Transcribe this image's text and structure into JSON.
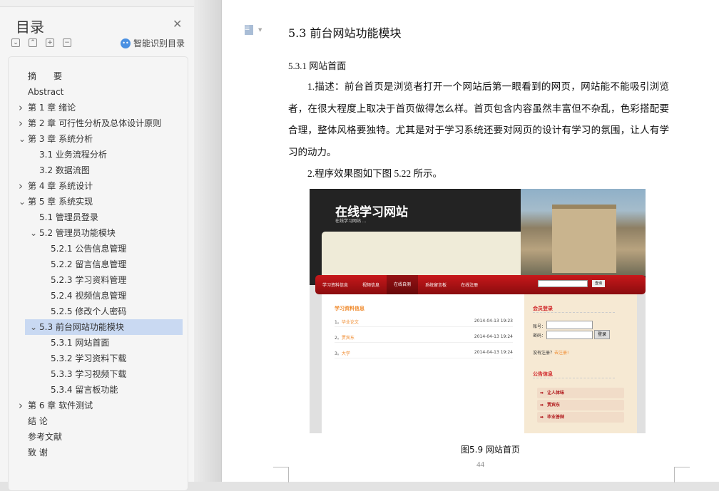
{
  "toc_panel": {
    "title": "目录",
    "smart_label": "智能识别目录",
    "items": [
      {
        "label": "摘　　要",
        "level": 0,
        "chev": ""
      },
      {
        "label": "Abstract",
        "level": 0,
        "chev": ""
      },
      {
        "label": "第 1 章  绪论",
        "level": 0,
        "chev": ">"
      },
      {
        "label": "第 2 章  可行性分析及总体设计原则",
        "level": 0,
        "chev": ">"
      },
      {
        "label": "第 3 章  系统分析",
        "level": 0,
        "chev": "v"
      },
      {
        "label": "3.1 业务流程分析",
        "level": 1,
        "chev": ""
      },
      {
        "label": "3.2 数据流图",
        "level": 1,
        "chev": ""
      },
      {
        "label": "第 4 章  系统设计",
        "level": 0,
        "chev": ">"
      },
      {
        "label": "第 5 章  系统实现",
        "level": 0,
        "chev": "v"
      },
      {
        "label": "5.1 管理员登录",
        "level": 1,
        "chev": ""
      },
      {
        "label": "5.2 管理员功能模块",
        "level": 1,
        "chev": "v"
      },
      {
        "label": "5.2.1 公告信息管理",
        "level": 2,
        "chev": ""
      },
      {
        "label": "5.2.2 留言信息管理",
        "level": 2,
        "chev": ""
      },
      {
        "label": "5.2.3 学习资料管理",
        "level": 2,
        "chev": ""
      },
      {
        "label": "5.2.4 视频信息管理",
        "level": 2,
        "chev": ""
      },
      {
        "label": "5.2.5 修改个人密码",
        "level": 2,
        "chev": ""
      },
      {
        "label": "5.3 前台网站功能模块",
        "level": 1,
        "chev": "v",
        "selected": true
      },
      {
        "label": "5.3.1 网站首面",
        "level": 2,
        "chev": ""
      },
      {
        "label": "5.3.2 学习资料下载",
        "level": 2,
        "chev": ""
      },
      {
        "label": "5.3.3 学习视频下载",
        "level": 2,
        "chev": ""
      },
      {
        "label": "5.3.4 留言板功能",
        "level": 2,
        "chev": ""
      },
      {
        "label": "第 6 章  软件测试",
        "level": 0,
        "chev": ">"
      },
      {
        "label": "结  论",
        "level": 0,
        "chev": ""
      },
      {
        "label": "参考文献",
        "level": 0,
        "chev": ""
      },
      {
        "label": "致    谢",
        "level": 0,
        "chev": ""
      }
    ]
  },
  "document": {
    "heading": "5.3 前台网站功能模块",
    "subheading": "5.3.1 网站首面",
    "para1": "1.描述：前台首页是浏览者打开一个网站后第一眼看到的网页，网站能不能吸引浏览者，在很大程度上取决于首页做得怎么样。首页包含内容虽然丰富但不杂乱，色彩搭配要合理，整体风格要独特。尤其是对于学习系统还要对网页的设计有学习的氛围，让人有学习的动力。",
    "para2": "2.程序效果图如下图 5.22 所示。",
    "caption": "图5.9 网站首页",
    "page_number": "44"
  },
  "screenshot": {
    "site_title": "在线学习网站",
    "site_sub": "在线学习网站 ...",
    "nav": [
      "学习资料信息",
      "视频信息",
      "在线自测",
      "系统留言板",
      "在线注册"
    ],
    "search_btn": "查询",
    "list_title": "学习资料信息",
    "list": [
      {
        "n": "1。",
        "t": "毕业论文",
        "d": "2014-04-13 19:23"
      },
      {
        "n": "2。",
        "t": "贾宾东",
        "d": "2014-04-13 19:24"
      },
      {
        "n": "3。",
        "t": "大学",
        "d": "2014-04-13 19:24"
      }
    ],
    "login_title": "会员登录",
    "account_label": "账号：",
    "password_label": "密码：",
    "login_btn": "登录",
    "reg_text": "没有注册？",
    "reg_link": "去注册!",
    "notice_title": "公告信息",
    "notices": [
      "让人体味",
      "贾宾东",
      "毕业答辩"
    ]
  },
  "colors": {
    "selected": "#c9d9f2",
    "nav_red": "#c8181b",
    "accent_orange": "#f08a2c"
  }
}
